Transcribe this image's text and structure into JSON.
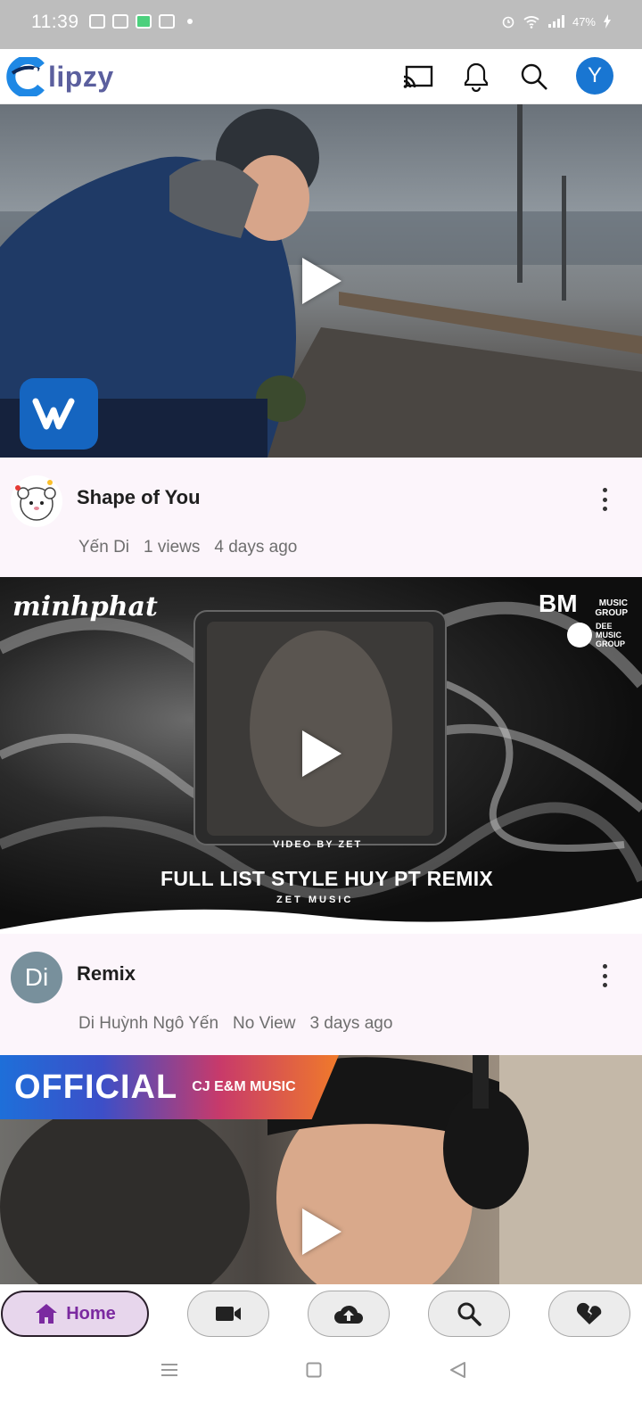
{
  "status_bar": {
    "time": "11:39",
    "battery": "47%"
  },
  "app": {
    "logo_text": "lipzy",
    "avatar_letter": "Y",
    "brand_color": "#5b5f9e",
    "avatar_color": "#1976d2"
  },
  "videos": [
    {
      "title": "Shape of You",
      "channel": "Yến Di",
      "views": "1 views",
      "age": "4 days ago"
    },
    {
      "title": "Remix",
      "channel_initials": "Di",
      "channel": "Di Huỳnh Ngô Yến",
      "views": "No View",
      "age": "3 days ago",
      "thumb_text_left": "minhphat",
      "thumb_text_video_by": "VIDEO BY ZET",
      "thumb_text_title": "FULL LIST STYLE HUY PT REMIX",
      "thumb_text_brand": "ZET MUSIC",
      "thumb_text_bm": "BM",
      "thumb_text_music_group": "MUSIC GROUP",
      "thumb_text_dee": "DEE MUSIC GROUP"
    },
    {
      "thumb_text_official": "OFFICIAL",
      "thumb_text_label": "CJ E&M MUSIC"
    }
  ],
  "bottom_nav": {
    "home_label": "Home",
    "active_color": "#7b2aa0"
  }
}
